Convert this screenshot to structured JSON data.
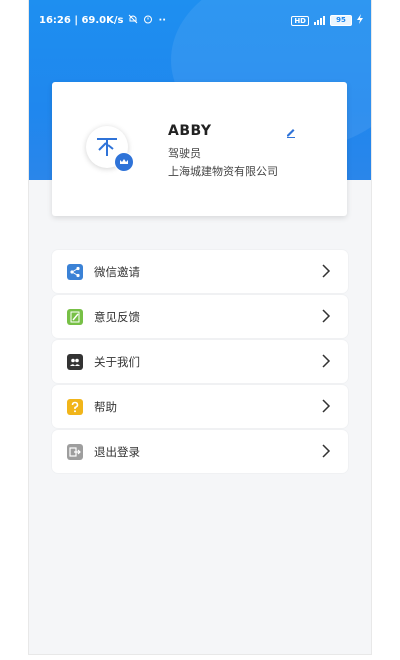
{
  "status_bar": {
    "time_speed": "16:26 | 69.0K/s",
    "network_badge": "HD",
    "signal_text": "4G+",
    "battery": "95",
    "icons": [
      "mute-icon",
      "alarm-icon",
      "more-dots-icon",
      "signal-icon",
      "battery-icon",
      "charging-icon"
    ]
  },
  "profile": {
    "name": "ABBY",
    "role": "驾驶员",
    "company": "上海城建物资有限公司",
    "avatar_glyph": "不"
  },
  "menu": {
    "items": [
      {
        "label": "微信邀请",
        "icon": "share-icon",
        "color": "#3b82d6"
      },
      {
        "label": "意见反馈",
        "icon": "feedback-icon",
        "color": "#77c046"
      },
      {
        "label": "关于我们",
        "icon": "about-us-icon",
        "color": "#333333"
      },
      {
        "label": "帮助",
        "icon": "help-icon",
        "color": "#f1b51a"
      },
      {
        "label": "退出登录",
        "icon": "logout-icon",
        "color": "#9e9e9e"
      }
    ]
  },
  "colors": {
    "header_blue": "#1f87ee",
    "avatar_badge": "#2f73d8",
    "page_bg": "#f5f6f8"
  }
}
